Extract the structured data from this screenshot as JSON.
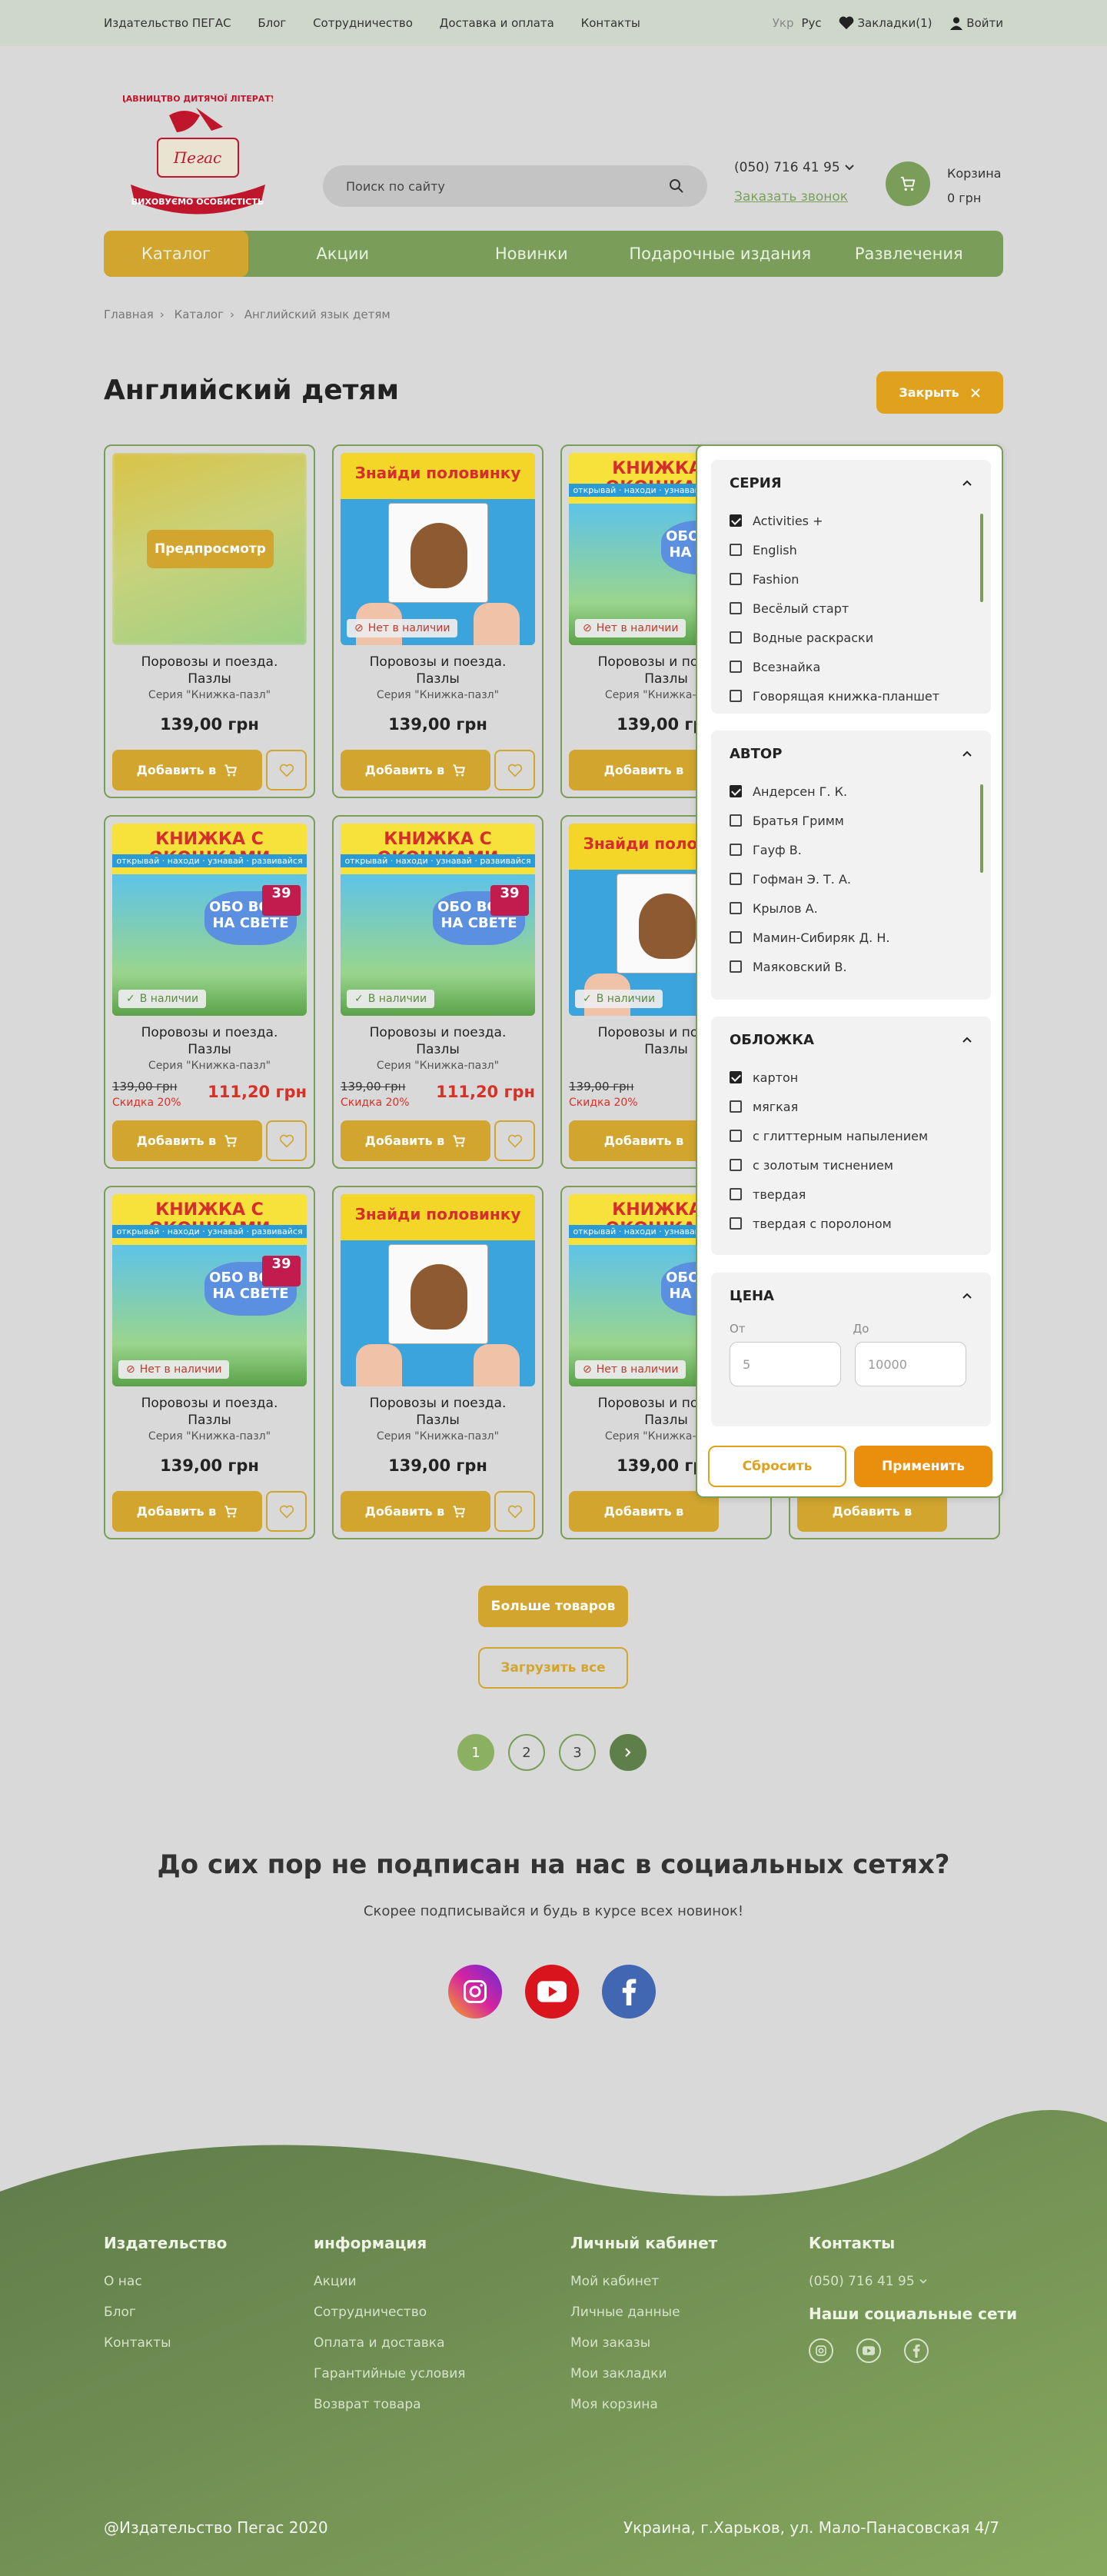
{
  "topbar": {
    "links": [
      "Издательство ПЕГАС",
      "Блог",
      "Сотрудничество",
      "Доставка и оплата",
      "Контакты"
    ],
    "lang_ukr": "Укр",
    "lang_rus": "Рус",
    "bookmarks": "Закладки(1)",
    "login": "Войти"
  },
  "header": {
    "search_placeholder": "Поиск по сайту",
    "phone": "(050) 716 41 95",
    "callback": "Заказать звонок",
    "cart_label": "Корзина",
    "cart_total": "0 грн"
  },
  "logo": {
    "line1": "ВИДАВНИЦТВО ДИТЯЧОЇ ЛІТЕРАТУРИ",
    "brand": "Пегас",
    "ribbon": "ВИХОВУЄМО ОСОБИСТІСТЬ"
  },
  "nav": [
    "Каталог",
    "Акции",
    "Новинки",
    "Подарочные издания",
    "Развлечения"
  ],
  "breadcrumb": [
    "Главная",
    "Каталог",
    "Английский язык детям"
  ],
  "page_title": "Английский детям",
  "close_label": "Закрыть",
  "card_texts": {
    "name_line1": "Поровозы и поездa.",
    "name_line2": "Пазлы",
    "series": "Серия \"Книжка-пазл\"",
    "price": "139,00 грн",
    "old_price": "139,00 грн",
    "discount": "Скидка 20%",
    "new_price": "111,20 грн",
    "add_label": "Добавить в",
    "preview": "Предпросмотр",
    "out_of_stock": "Нет в наличии",
    "in_stock": "В наличии",
    "book_title": "КНИЖКА С ОКОШКАМИ",
    "book_sub": "открывай · находи · узнавай · развивайся",
    "book_blob": "ОБО ВСЁМ НА СВЕТЕ",
    "book_count": "39",
    "puzzle_title": "Знайди половинку"
  },
  "filters": {
    "series": {
      "title": "СЕРИЯ",
      "options": [
        {
          "label": "Activities +",
          "checked": true
        },
        {
          "label": "English",
          "checked": false
        },
        {
          "label": "Fashion",
          "checked": false
        },
        {
          "label": "Весёлый старт",
          "checked": false
        },
        {
          "label": "Водные раскраски",
          "checked": false
        },
        {
          "label": "Всезнайка",
          "checked": false
        },
        {
          "label": "Говорящая книжка-планшет",
          "checked": false
        }
      ]
    },
    "author": {
      "title": "АВТОР",
      "options": [
        {
          "label": "Андерсен Г. К.",
          "checked": true
        },
        {
          "label": "Братья Гримм",
          "checked": false
        },
        {
          "label": "Гауф В.",
          "checked": false
        },
        {
          "label": "Гофман Э. Т. А.",
          "checked": false
        },
        {
          "label": "Крылов А.",
          "checked": false
        },
        {
          "label": "Мамин-Сибиряк Д. Н.",
          "checked": false
        },
        {
          "label": "Маяковский В.",
          "checked": false
        }
      ]
    },
    "cover": {
      "title": "ОБЛОЖКА",
      "options": [
        {
          "label": "картон",
          "checked": true
        },
        {
          "label": "мягкая",
          "checked": false
        },
        {
          "label": "с глиттерным напылением",
          "checked": false
        },
        {
          "label": "с золотым тиснением",
          "checked": false
        },
        {
          "label": "твердая",
          "checked": false
        },
        {
          "label": "твердая с поролоном",
          "checked": false
        }
      ]
    },
    "price": {
      "title": "ЦЕНА",
      "from_label": "От",
      "to_label": "До",
      "from_value": "5",
      "to_value": "10000"
    },
    "reset": "Сбросить",
    "apply": "Применить"
  },
  "more_label": "Больше товаров",
  "load_all_label": "Загрузить все",
  "pages": [
    "1",
    "2",
    "3"
  ],
  "social": {
    "title": "До сих пор не подписан на нас в социальных сетях?",
    "subtitle": "Скорее подписывайся и будь в курсе всех новинок!"
  },
  "footer": {
    "col1": {
      "title": "Издательство",
      "links": [
        "О нас",
        "Блог",
        "Контакты"
      ]
    },
    "col2": {
      "title": "информация",
      "links": [
        "Акции",
        "Сотрудничество",
        "Оплата и доставка",
        "Гарантийные условия",
        "Возврат товара"
      ]
    },
    "col3": {
      "title": "Личный кабинет",
      "links": [
        "Мой кабинет",
        "Личные данные",
        "Мои заказы",
        "Мои закладки",
        "Моя корзина"
      ]
    },
    "col4": {
      "title": "Контакты",
      "phone": "(050) 716 41 95",
      "social_title": "Наши социальные сети"
    },
    "copyright": "@Издательство Пегас 2020",
    "address": "Украина,  г.Харьков, ул. Мало-Панасовская 4/7"
  },
  "colors": {
    "accent_green": "#7a9e5a",
    "accent_gold": "#d1a52e",
    "accent_orange": "#e98f0d"
  }
}
